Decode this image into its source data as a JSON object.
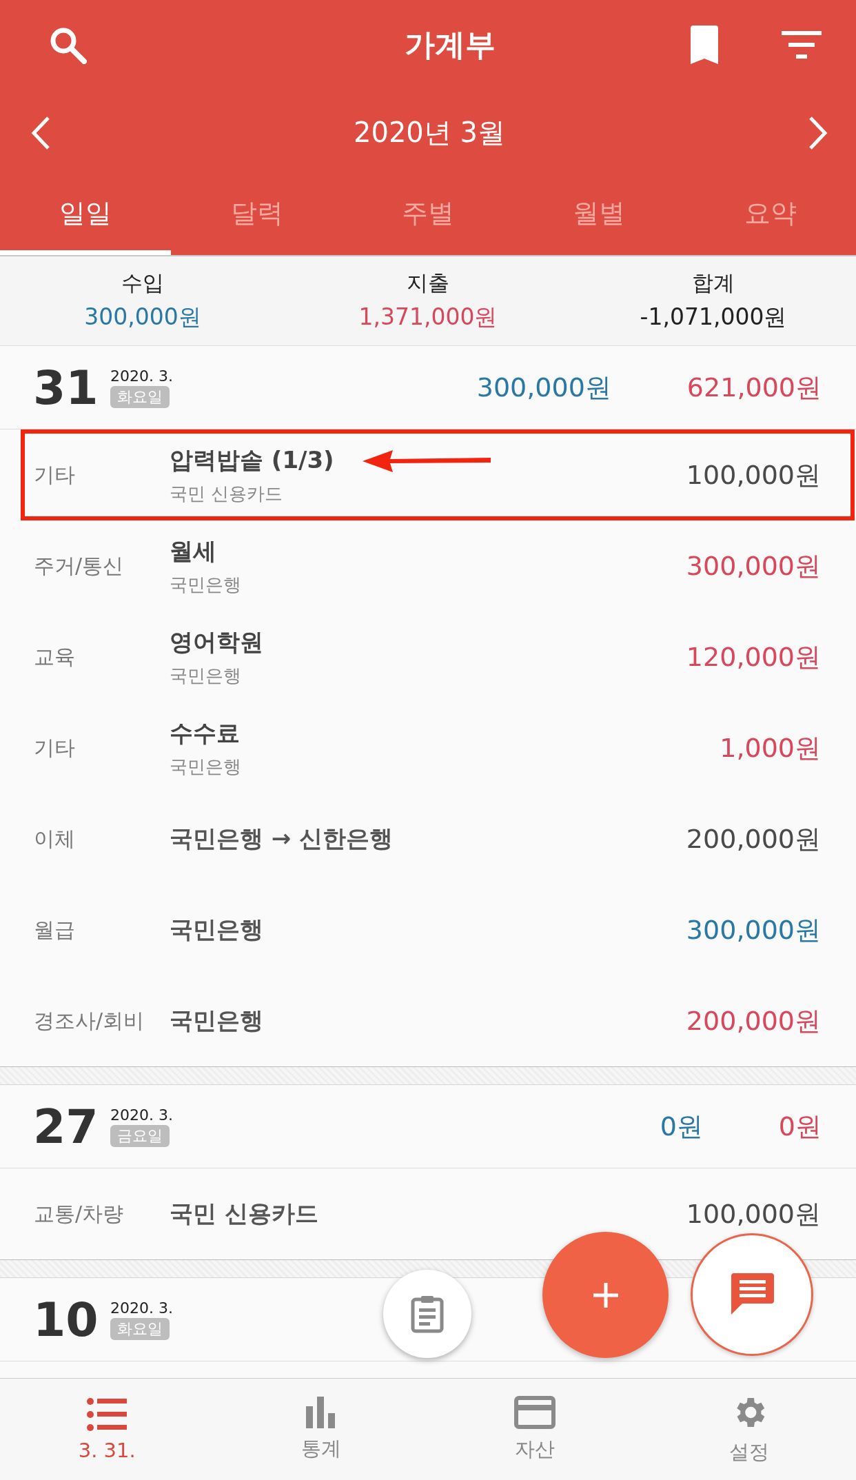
{
  "header": {
    "title": "가계부",
    "month": "2020년 3월"
  },
  "tabs": [
    {
      "label": "일일",
      "selected": true
    },
    {
      "label": "달력",
      "selected": false
    },
    {
      "label": "주별",
      "selected": false
    },
    {
      "label": "월별",
      "selected": false
    },
    {
      "label": "요약",
      "selected": false
    }
  ],
  "summary": [
    {
      "label": "수입",
      "value": "300,000원",
      "kind": "income"
    },
    {
      "label": "지출",
      "value": "1,371,000원",
      "kind": "expense"
    },
    {
      "label": "합계",
      "value": "-1,071,000원",
      "kind": "total"
    }
  ],
  "days": [
    {
      "day": "31",
      "date": "2020. 3.",
      "weekday": "화요일",
      "income": "300,000원",
      "expense": "621,000원",
      "entries": [
        {
          "category": "기타",
          "title": "압력밥솥 (1/3)",
          "account": "국민 신용카드",
          "amount": "100,000원",
          "kind": "card",
          "highlighted": true
        },
        {
          "category": "주거/통신",
          "title": "월세",
          "account": "국민은행",
          "amount": "300,000원",
          "kind": "expense",
          "highlighted": false
        },
        {
          "category": "교육",
          "title": "영어학원",
          "account": "국민은행",
          "amount": "120,000원",
          "kind": "expense",
          "highlighted": false
        },
        {
          "category": "기타",
          "title": "수수료",
          "account": "국민은행",
          "amount": "1,000원",
          "kind": "expense",
          "highlighted": false
        },
        {
          "category": "이체",
          "title": "국민은행 → 신한은행",
          "amount": "200,000원",
          "kind": "transfer",
          "highlighted": false
        },
        {
          "category": "월급",
          "title": "국민은행",
          "amount": "300,000원",
          "kind": "income",
          "highlighted": false
        },
        {
          "category": "경조사/회비",
          "title": "국민은행",
          "amount": "200,000원",
          "kind": "expense",
          "highlighted": false
        }
      ]
    },
    {
      "day": "27",
      "date": "2020. 3.",
      "weekday": "금요일",
      "income": "0원",
      "expense": "0원",
      "entries": [
        {
          "category": "교통/차량",
          "title": "국민 신용카드",
          "amount": "100,000원",
          "kind": "card",
          "highlighted": false
        }
      ]
    },
    {
      "day": "10",
      "date": "2020. 3.",
      "weekday": "화요일"
    }
  ],
  "bottom_nav": [
    {
      "label": "3. 31.",
      "selected": true
    },
    {
      "label": "통계",
      "selected": false
    },
    {
      "label": "자산",
      "selected": false
    },
    {
      "label": "설정",
      "selected": false
    }
  ]
}
